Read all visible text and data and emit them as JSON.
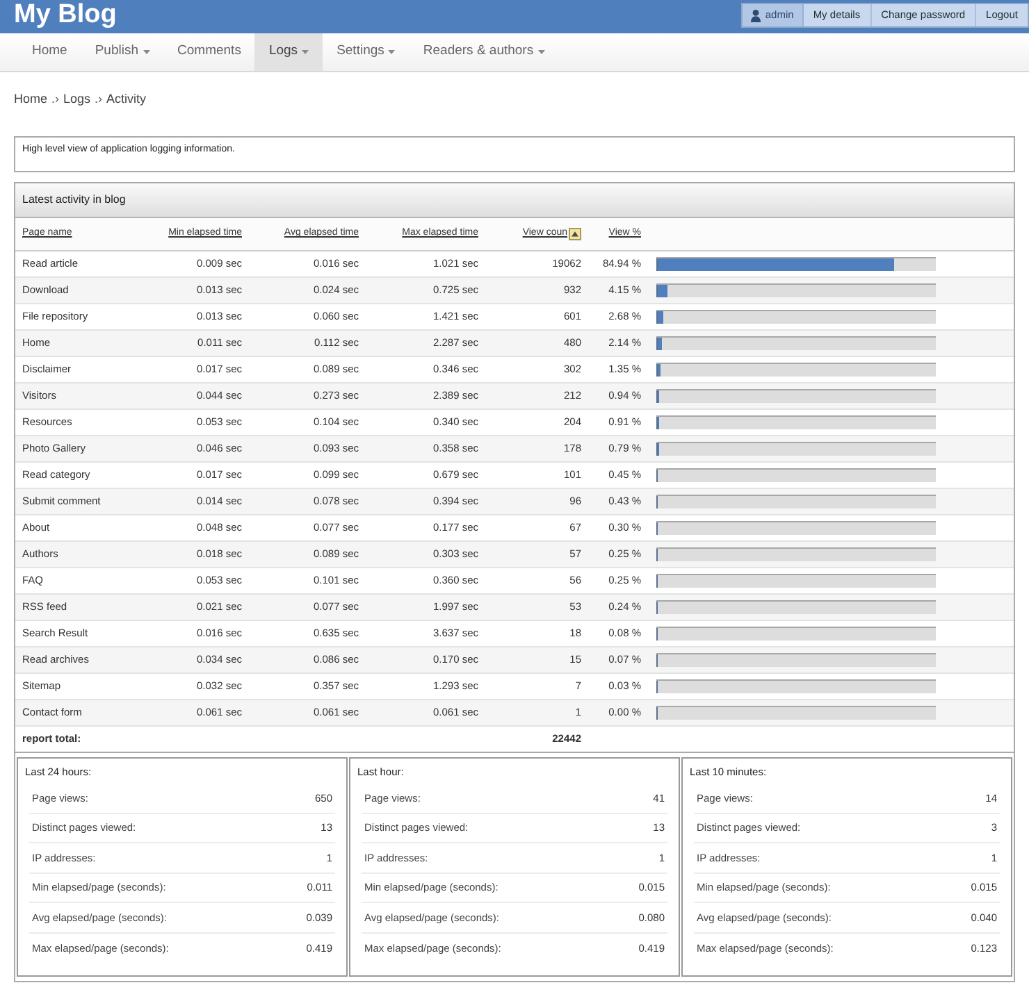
{
  "header": {
    "title": "My Blog",
    "user_menu": [
      {
        "label": "admin",
        "kind": "user"
      },
      {
        "label": "My details",
        "kind": "link"
      },
      {
        "label": "Change password",
        "kind": "link"
      },
      {
        "label": "Logout",
        "kind": "link"
      }
    ]
  },
  "nav": [
    {
      "label": "Home",
      "dropdown": false,
      "selected": false
    },
    {
      "label": "Publish",
      "dropdown": true,
      "selected": false
    },
    {
      "label": "Comments",
      "dropdown": false,
      "selected": false
    },
    {
      "label": "Logs",
      "dropdown": true,
      "selected": true
    },
    {
      "label": "Settings",
      "dropdown": true,
      "selected": false
    },
    {
      "label": "Readers & authors",
      "dropdown": true,
      "selected": false
    }
  ],
  "breadcrumb": [
    {
      "label": "Home",
      "separator": ".›"
    },
    {
      "label": "Logs",
      "separator": ".›"
    },
    {
      "label": "Activity"
    }
  ],
  "description": "High level view of application logging information.",
  "activity": {
    "title": "Latest activity in blog",
    "columns": [
      {
        "label": "Page name",
        "sorted": false
      },
      {
        "label": "Min elapsed time",
        "sorted": false
      },
      {
        "label": "Avg elapsed time",
        "sorted": false
      },
      {
        "label": "Max elapsed time",
        "sorted": false
      },
      {
        "label": "View coun",
        "sorted": true
      },
      {
        "label": "View %",
        "sorted": false
      }
    ],
    "rows": [
      {
        "page": "Read article",
        "min": "0.009 sec",
        "avg": "0.016 sec",
        "max": "1.021 sec",
        "count": "19062",
        "percent": "84.94 %",
        "level": 0.8494
      },
      {
        "page": "Download",
        "min": "0.013 sec",
        "avg": "0.024 sec",
        "max": "0.725 sec",
        "count": "932",
        "percent": "4.15 %",
        "level": 0.0415
      },
      {
        "page": "File repository",
        "min": "0.013 sec",
        "avg": "0.060 sec",
        "max": "1.421 sec",
        "count": "601",
        "percent": "2.68 %",
        "level": 0.0268
      },
      {
        "page": "Home",
        "min": "0.011 sec",
        "avg": "0.112 sec",
        "max": "2.287 sec",
        "count": "480",
        "percent": "2.14 %",
        "level": 0.0214
      },
      {
        "page": "Disclaimer",
        "min": "0.017 sec",
        "avg": "0.089 sec",
        "max": "0.346 sec",
        "count": "302",
        "percent": "1.35 %",
        "level": 0.0135
      },
      {
        "page": "Visitors",
        "min": "0.044 sec",
        "avg": "0.273 sec",
        "max": "2.389 sec",
        "count": "212",
        "percent": "0.94 %",
        "level": 0.0094
      },
      {
        "page": "Resources",
        "min": "0.053 sec",
        "avg": "0.104 sec",
        "max": "0.340 sec",
        "count": "204",
        "percent": "0.91 %",
        "level": 0.0091
      },
      {
        "page": "Photo Gallery",
        "min": "0.046 sec",
        "avg": "0.093 sec",
        "max": "0.358 sec",
        "count": "178",
        "percent": "0.79 %",
        "level": 0.0079
      },
      {
        "page": "Read category",
        "min": "0.017 sec",
        "avg": "0.099 sec",
        "max": "0.679 sec",
        "count": "101",
        "percent": "0.45 %",
        "level": 0.0045
      },
      {
        "page": "Submit comment",
        "min": "0.014 sec",
        "avg": "0.078 sec",
        "max": "0.394 sec",
        "count": "96",
        "percent": "0.43 %",
        "level": 0.0043
      },
      {
        "page": "About",
        "min": "0.048 sec",
        "avg": "0.077 sec",
        "max": "0.177 sec",
        "count": "67",
        "percent": "0.30 %",
        "level": 0.003
      },
      {
        "page": "Authors",
        "min": "0.018 sec",
        "avg": "0.089 sec",
        "max": "0.303 sec",
        "count": "57",
        "percent": "0.25 %",
        "level": 0.0025
      },
      {
        "page": "FAQ",
        "min": "0.053 sec",
        "avg": "0.101 sec",
        "max": "0.360 sec",
        "count": "56",
        "percent": "0.25 %",
        "level": 0.0025
      },
      {
        "page": "RSS feed",
        "min": "0.021 sec",
        "avg": "0.077 sec",
        "max": "1.997 sec",
        "count": "53",
        "percent": "0.24 %",
        "level": 0.0024
      },
      {
        "page": "Search Result",
        "min": "0.016 sec",
        "avg": "0.635 sec",
        "max": "3.637 sec",
        "count": "18",
        "percent": "0.08 %",
        "level": 0.0008
      },
      {
        "page": "Read archives",
        "min": "0.034 sec",
        "avg": "0.086 sec",
        "max": "0.170 sec",
        "count": "15",
        "percent": "0.07 %",
        "level": 0.0007
      },
      {
        "page": "Sitemap",
        "min": "0.032 sec",
        "avg": "0.357 sec",
        "max": "1.293 sec",
        "count": "7",
        "percent": "0.03 %",
        "level": 0.0003
      },
      {
        "page": "Contact form",
        "min": "0.061 sec",
        "avg": "0.061 sec",
        "max": "0.061 sec",
        "count": "1",
        "percent": "0.00 %",
        "level": 0
      }
    ],
    "total": {
      "label": "report total:",
      "count": "22442"
    }
  },
  "stats": [
    {
      "title": "Last 24 hours:",
      "rows": [
        {
          "label": "Page views:",
          "value": "650"
        },
        {
          "label": "Distinct pages viewed:",
          "value": "13"
        },
        {
          "label": "IP addresses:",
          "value": "1"
        },
        {
          "label": "Min elapsed/page (seconds):",
          "value": "0.011"
        },
        {
          "label": "Avg elapsed/page (seconds):",
          "value": "0.039"
        },
        {
          "label": "Max elapsed/page (seconds):",
          "value": "0.419"
        }
      ]
    },
    {
      "title": "Last hour:",
      "rows": [
        {
          "label": "Page views:",
          "value": "41"
        },
        {
          "label": "Distinct pages viewed:",
          "value": "13"
        },
        {
          "label": "IP addresses:",
          "value": "1"
        },
        {
          "label": "Min elapsed/page (seconds):",
          "value": "0.015"
        },
        {
          "label": "Avg elapsed/page (seconds):",
          "value": "0.080"
        },
        {
          "label": "Max elapsed/page (seconds):",
          "value": "0.419"
        }
      ]
    },
    {
      "title": "Last 10 minutes:",
      "rows": [
        {
          "label": "Page views:",
          "value": "14"
        },
        {
          "label": "Distinct pages viewed:",
          "value": "3"
        },
        {
          "label": "IP addresses:",
          "value": "1"
        },
        {
          "label": "Min elapsed/page (seconds):",
          "value": "0.015"
        },
        {
          "label": "Avg elapsed/page (seconds):",
          "value": "0.040"
        },
        {
          "label": "Max elapsed/page (seconds):",
          "value": "0.123"
        }
      ]
    }
  ]
}
